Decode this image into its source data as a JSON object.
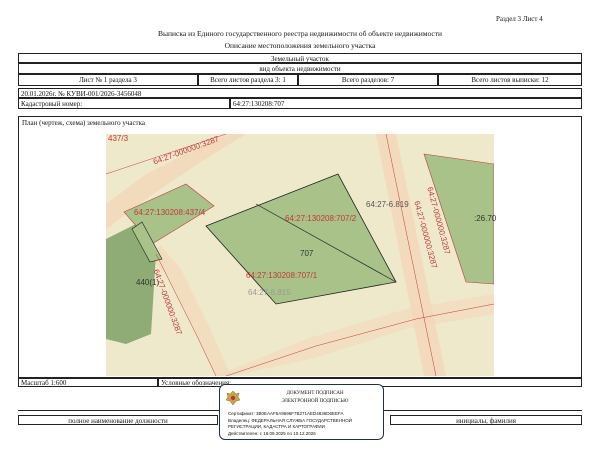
{
  "header": {
    "section_info": "Раздел 3    Лист 4",
    "title": "Выписка из Единого государственного реестра недвижимости об объекте недвижимости",
    "subtitle": "Описание местоположения земельного участка"
  },
  "object": {
    "type": "Земельный участок",
    "type_caption": "вид объекта недвижимости"
  },
  "sheet_row": {
    "sheet": "Лист № 1 раздела 3",
    "total_in_section": "Всего листов раздела 3: 1",
    "total_sections": "Всего разделов: 7",
    "total_sheets": "Всего листов выписки: 12"
  },
  "doc_number": "20.01.2026г. № КУВИ-001/2026-3456048",
  "cadastral": {
    "label": "Кадастровый номер:",
    "value": "64:27:130208:707"
  },
  "plan": {
    "caption": "План (чертеж, схема) земельного участка",
    "labels": {
      "top_left": "437/3",
      "road_top": "64:27-000000:3287",
      "left_parcel": "64:27:130208:437/4",
      "parcel_upper": "64:27:130208:707/2",
      "parcel_lower": "64:27:130208:707/1",
      "grey_right": "64:27-6.819",
      "parcel_number": "707",
      "grey_bottom": "64:27-6.815",
      "left_440": "440(1)",
      "road_bottom": "64:27-000000:3287",
      "right_road_a": "64:27-000000:3287",
      "right_road_b": "64:27-000000:3287",
      "right_edge": ":26.70"
    }
  },
  "footer": {
    "scale": "Масштаб 1:600",
    "legend": "Условные обозначения:",
    "position_caption": "полное наименование должности",
    "name_caption": "инициалы, фамилия"
  },
  "signature_stamp": {
    "line1": "ДОКУМЕНТ ПОДПИСАН",
    "line2": "ЭЛЕКТРОННОЙ ПОДПИСЬЮ",
    "cert": "Сертификат: 3B0EAAF5A9696F7B271AED4836D6EEFA",
    "owner": "Владелец: ФЕДЕРАЛЬНАЯ СЛУЖБА ГОСУДАРСТВЕННОЙ",
    "owner2": "РЕГИСТРАЦИИ, КАДАСТРА И КАРТОГРАФИИ",
    "validity": "Действителен: с 16.09.2025 по 10.12.2026"
  },
  "colors": {
    "land": "#efe9cc",
    "parcel_green": "#a8c289",
    "dark_green": "#8fac76",
    "road_stripe": "#f3d7b9",
    "boundary_red": "#c0393b",
    "stamp_border": "#1f2f4d"
  }
}
